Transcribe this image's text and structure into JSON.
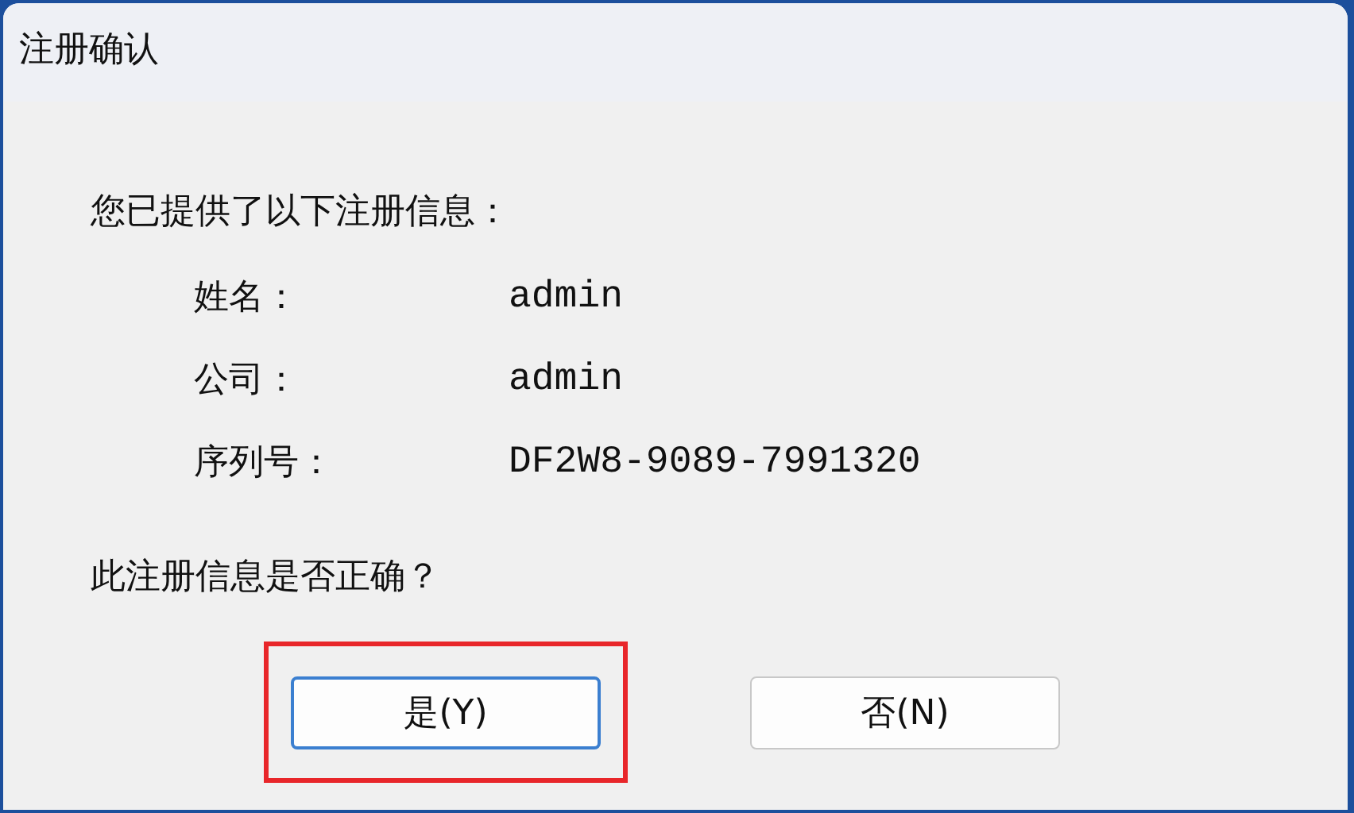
{
  "window": {
    "title": "注册确认"
  },
  "message": "您已提供了以下注册信息：",
  "fields": [
    {
      "label": "姓名：",
      "value": "admin"
    },
    {
      "label": "公司：",
      "value": "admin"
    },
    {
      "label": "序列号：",
      "value": "DF2W8-9089-7991320"
    }
  ],
  "question": "此注册信息是否正确？",
  "buttons": [
    {
      "label": "是(Y)",
      "focused": true,
      "highlighted": true
    },
    {
      "label": "否(N)",
      "focused": false,
      "highlighted": false
    }
  ]
}
